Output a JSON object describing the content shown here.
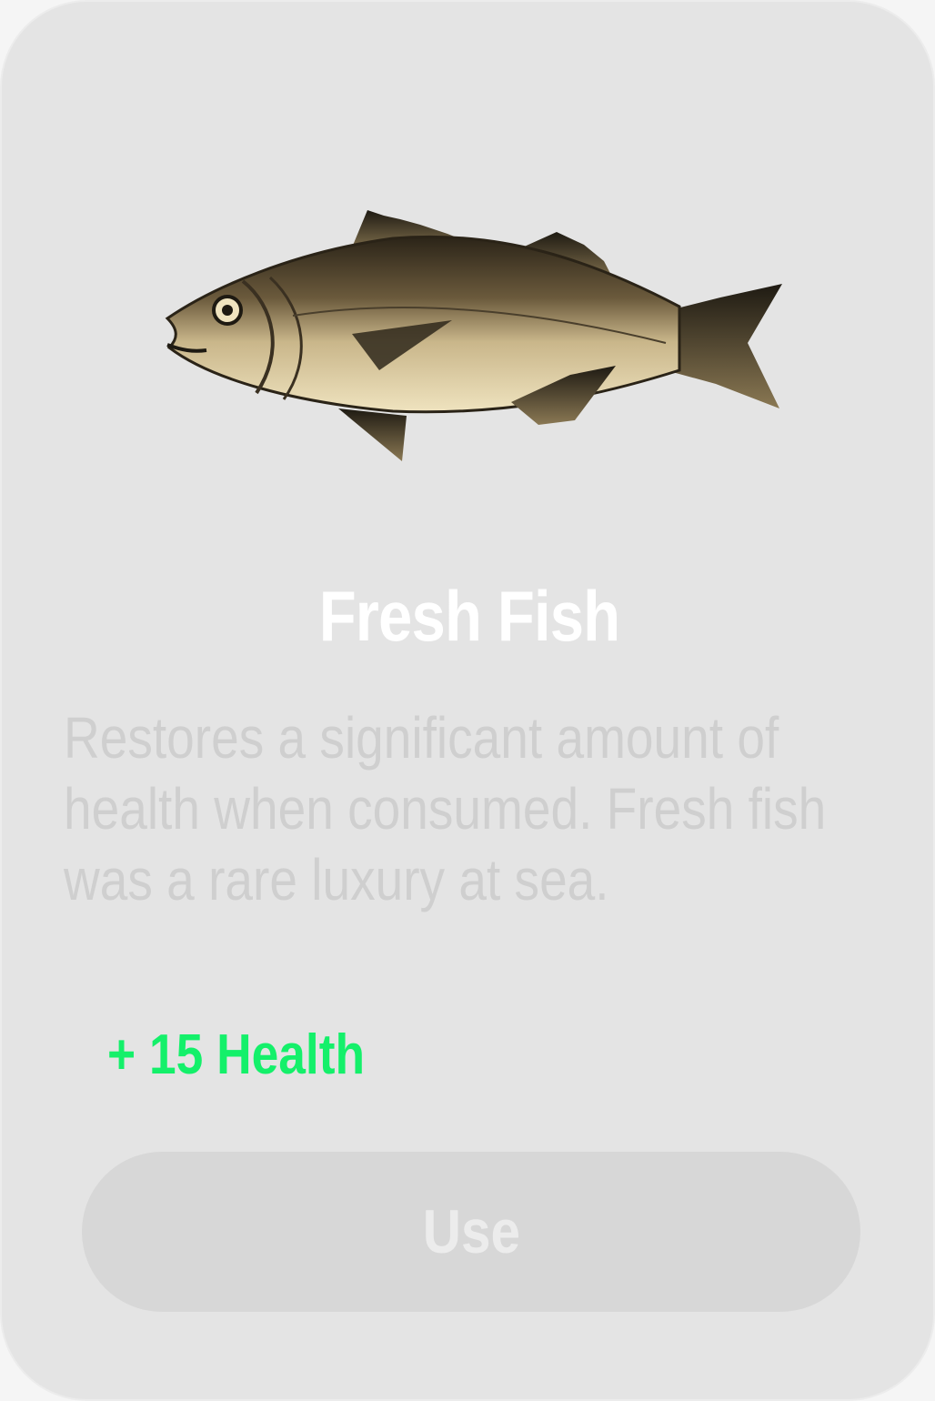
{
  "item": {
    "name": "Fresh Fish",
    "icon": "fish-icon",
    "description_lines": [
      "Restores a significant amount of",
      "health when consumed. Fresh fish",
      "was a rare luxury at sea."
    ],
    "effect": "+ 15 Health",
    "effect_color": "#14f06a"
  },
  "actions": {
    "use_label": "Use"
  }
}
